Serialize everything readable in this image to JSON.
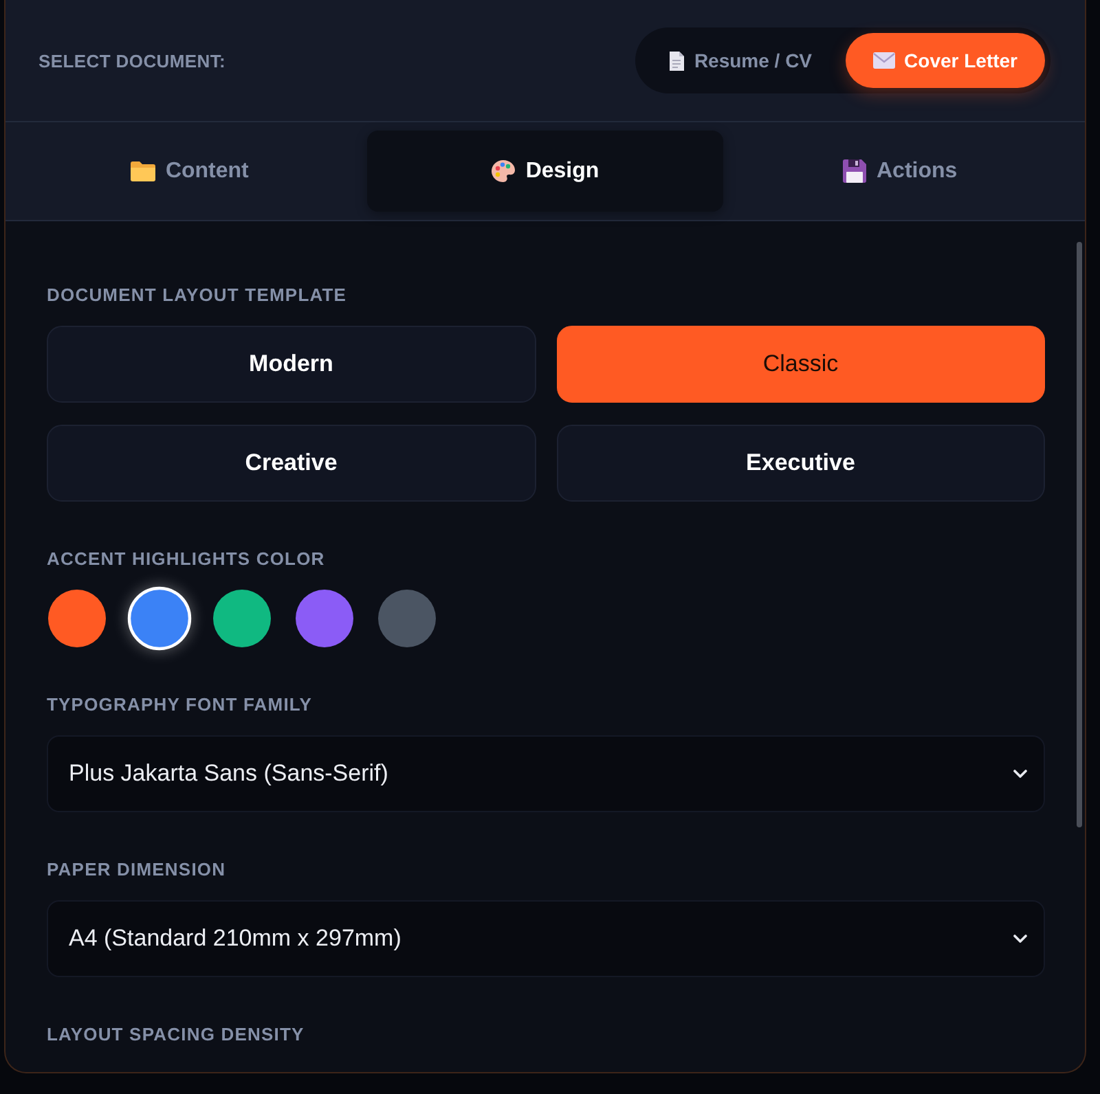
{
  "document_selector": {
    "label": "SELECT DOCUMENT:",
    "options": [
      {
        "label": "Resume / CV",
        "selected": false
      },
      {
        "label": "Cover Letter",
        "selected": true
      }
    ]
  },
  "tabs": [
    {
      "label": "Content",
      "selected": false
    },
    {
      "label": "Design",
      "selected": true
    },
    {
      "label": "Actions",
      "selected": false
    }
  ],
  "template": {
    "label": "DOCUMENT LAYOUT TEMPLATE",
    "options": [
      {
        "label": "Modern",
        "selected": false
      },
      {
        "label": "Classic",
        "selected": true
      },
      {
        "label": "Creative",
        "selected": false
      },
      {
        "label": "Executive",
        "selected": false
      }
    ]
  },
  "accent": {
    "label": "ACCENT HIGHLIGHTS COLOR",
    "swatches": [
      {
        "color": "#ff5a23",
        "selected": false
      },
      {
        "color": "#3b82f6",
        "selected": true
      },
      {
        "color": "#10b981",
        "selected": false
      },
      {
        "color": "#8b5cf6",
        "selected": false
      },
      {
        "color": "#4b5563",
        "selected": false
      }
    ]
  },
  "font_family": {
    "label": "TYPOGRAPHY FONT FAMILY",
    "value": "Plus Jakarta Sans (Sans-Serif)"
  },
  "paper": {
    "label": "PAPER DIMENSION",
    "value": "A4 (Standard 210mm x 297mm)"
  },
  "spacing": {
    "label": "LAYOUT SPACING DENSITY"
  }
}
